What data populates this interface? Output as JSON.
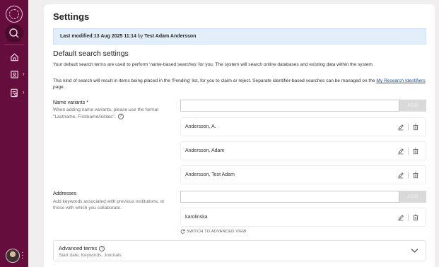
{
  "page": {
    "title": "Settings"
  },
  "banner": {
    "prefix": "Last modified: ",
    "date": "13 Aug 2025 11:14",
    "by": " by ",
    "user": "Test Adam Andersson"
  },
  "section": {
    "title": "Default search settings",
    "para1": "Your default search terms are used to perform 'name-based searches' for you. The system will search online databases and existing data within the system.",
    "para2_pre": "This kind of search will result in items being placed in the 'Pending' list, for you to claim or reject. Separate identifier-based searches can be managed on the ",
    "para2_link": "My Research Identifiers",
    "para2_post": " page."
  },
  "name_variants": {
    "label": "Name variants *",
    "hint": "When adding name variants, please use the format \"Lastname, Firstname/initials\".",
    "input_value": "",
    "add_label": "ADD",
    "items": [
      "Andersson, A.",
      "Andersson, Adam",
      "Andersson, Test Adam"
    ]
  },
  "addresses": {
    "label": "Addresses",
    "hint": "Add keywords associated with previous institutions, or those with which you collaborate.",
    "input_value": "",
    "add_label": "ADD",
    "items": [
      "karolinska"
    ]
  },
  "switch_view": {
    "label": "SWITCH TO ADVANCED VIEW"
  },
  "advanced": {
    "title": "Advanced terms",
    "subtitle": "Start date, Keywords, Journals"
  },
  "colors": {
    "sidebar": "#650e3e",
    "banner_bg": "#e3eefb",
    "link": "#1a4f9c"
  },
  "icons": [
    "logo-seal",
    "search-icon",
    "home-icon",
    "records-icon",
    "reports-icon",
    "edit-icon",
    "trash-icon",
    "help-icon",
    "refresh-icon",
    "chevron-down-icon"
  ]
}
